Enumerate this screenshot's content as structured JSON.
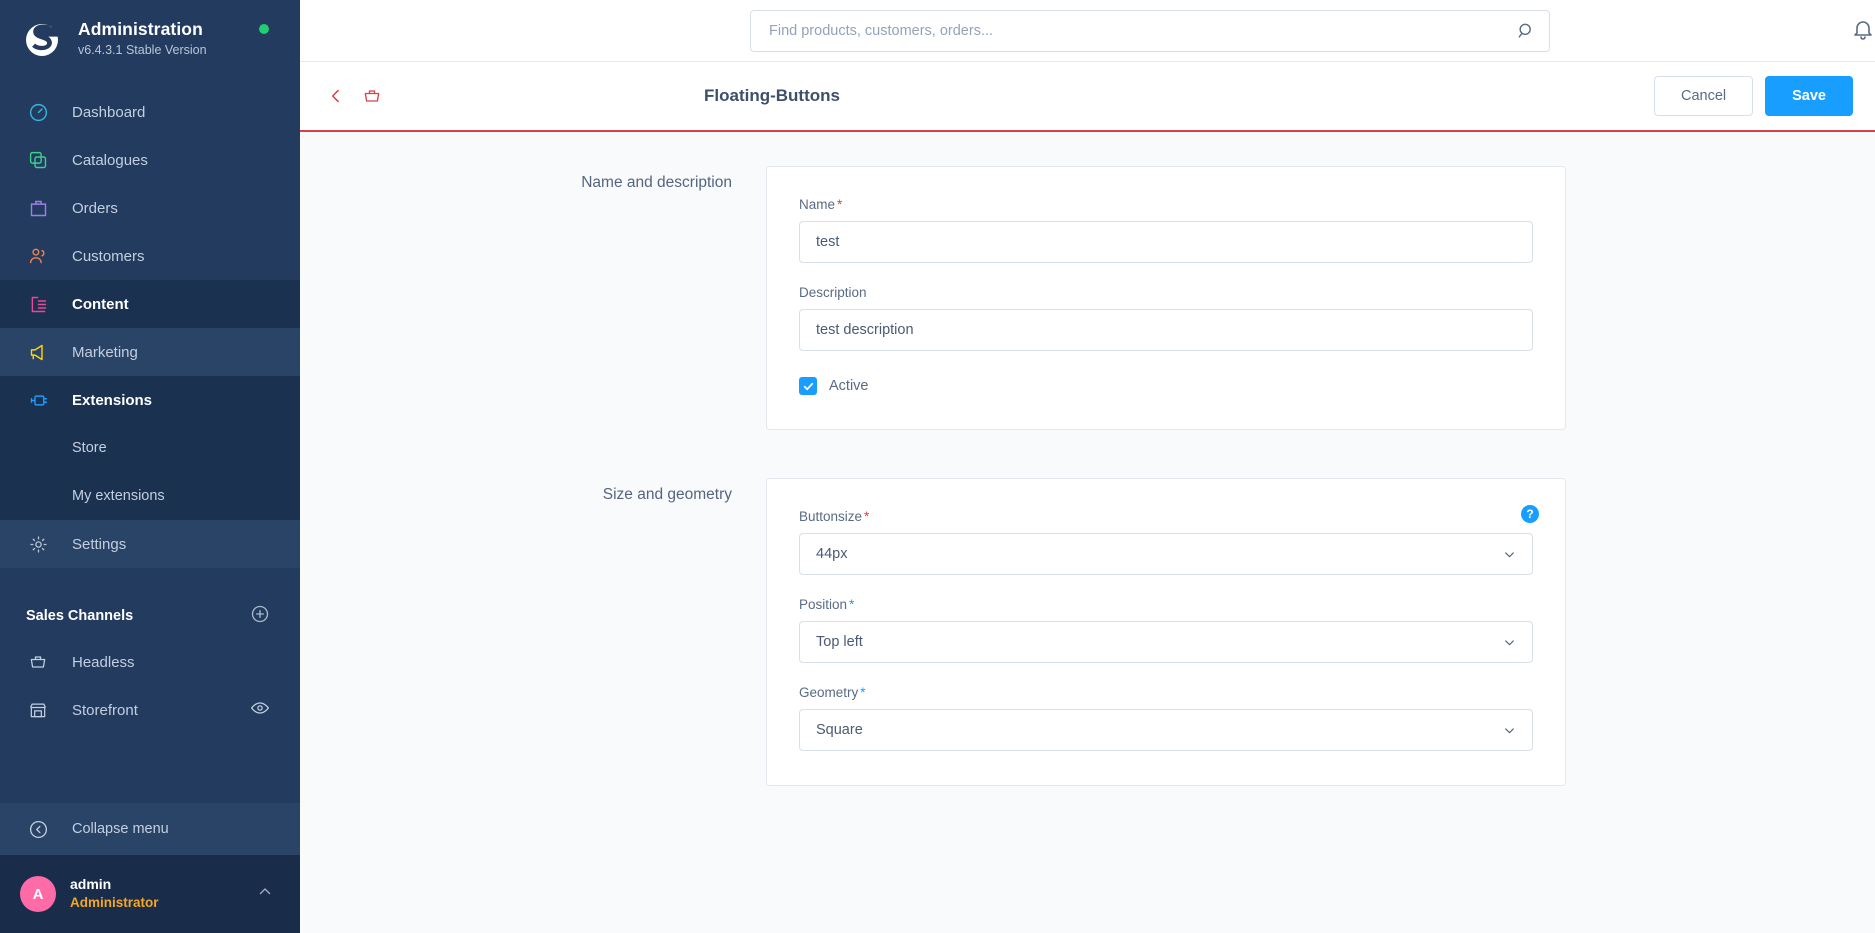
{
  "sidebar": {
    "title": "Administration",
    "version": "v6.4.3.1 Stable Version",
    "status_color": "#1fcf6d",
    "nav": [
      {
        "label": "Dashboard",
        "icon": "dashboard-icon",
        "color": "#37b6e0",
        "state": "normal"
      },
      {
        "label": "Catalogues",
        "icon": "catalogues-icon",
        "color": "#3ecf8e",
        "state": "normal"
      },
      {
        "label": "Orders",
        "icon": "orders-icon",
        "color": "#a07ee6",
        "state": "normal"
      },
      {
        "label": "Customers",
        "icon": "customers-icon",
        "color": "#f0814f",
        "state": "normal"
      },
      {
        "label": "Content",
        "icon": "content-icon",
        "color": "#ec4899",
        "state": "active"
      },
      {
        "label": "Marketing",
        "icon": "marketing-icon",
        "color": "#ffd60a",
        "state": "highlight"
      },
      {
        "label": "Extensions",
        "icon": "extensions-icon",
        "color": "#189eff",
        "state": "active"
      }
    ],
    "sub_items": [
      {
        "label": "Store"
      },
      {
        "label": "My extensions"
      }
    ],
    "settings": {
      "label": "Settings",
      "icon": "gear-icon"
    },
    "sales_channels": {
      "heading": "Sales Channels",
      "add_icon": "plus-circle-icon",
      "items": [
        {
          "label": "Headless",
          "icon": "basket-icon"
        },
        {
          "label": "Storefront",
          "icon": "store-icon",
          "trailing_icon": "eye-icon"
        }
      ]
    },
    "collapse": {
      "label": "Collapse menu",
      "icon": "collapse-icon"
    },
    "user": {
      "avatar_initial": "A",
      "avatar_color": "#ff6ba6",
      "name": "admin",
      "role": "Administrator",
      "role_color": "#f5a623",
      "chevron": "chevron-up-icon"
    }
  },
  "topbar": {
    "search": {
      "placeholder": "Find products, customers, orders...",
      "value": "",
      "icon": "search-icon"
    },
    "notification_icon": "bell-icon"
  },
  "pagehead": {
    "back_icon": "chevron-left-icon",
    "basket_icon": "basket-icon",
    "title": "Floating-Buttons",
    "cancel_label": "Cancel",
    "save_label": "Save",
    "save_color": "#189eff",
    "accent_color": "#d8414a"
  },
  "cards": [
    {
      "label": "Name and description",
      "fields": [
        {
          "key": "name",
          "label": "Name",
          "required": true,
          "required_color": "#d8414a",
          "value": "test",
          "type": "text"
        },
        {
          "key": "description",
          "label": "Description",
          "required": false,
          "value": "test description",
          "type": "text"
        }
      ],
      "checkbox": {
        "label": "Active",
        "checked": true,
        "color": "#189eff"
      }
    },
    {
      "label": "Size and geometry",
      "help_icon": "help-icon",
      "fields": [
        {
          "key": "buttonsize",
          "label": "Buttonsize",
          "required": true,
          "required_color": "#d8414a",
          "value": "44px",
          "type": "select"
        },
        {
          "key": "position",
          "label": "Position",
          "required": true,
          "required_color": "#189eff",
          "value": "Top left",
          "type": "select"
        },
        {
          "key": "geometry",
          "label": "Geometry",
          "required": true,
          "required_color": "#189eff",
          "value": "Square",
          "type": "select"
        }
      ]
    }
  ]
}
